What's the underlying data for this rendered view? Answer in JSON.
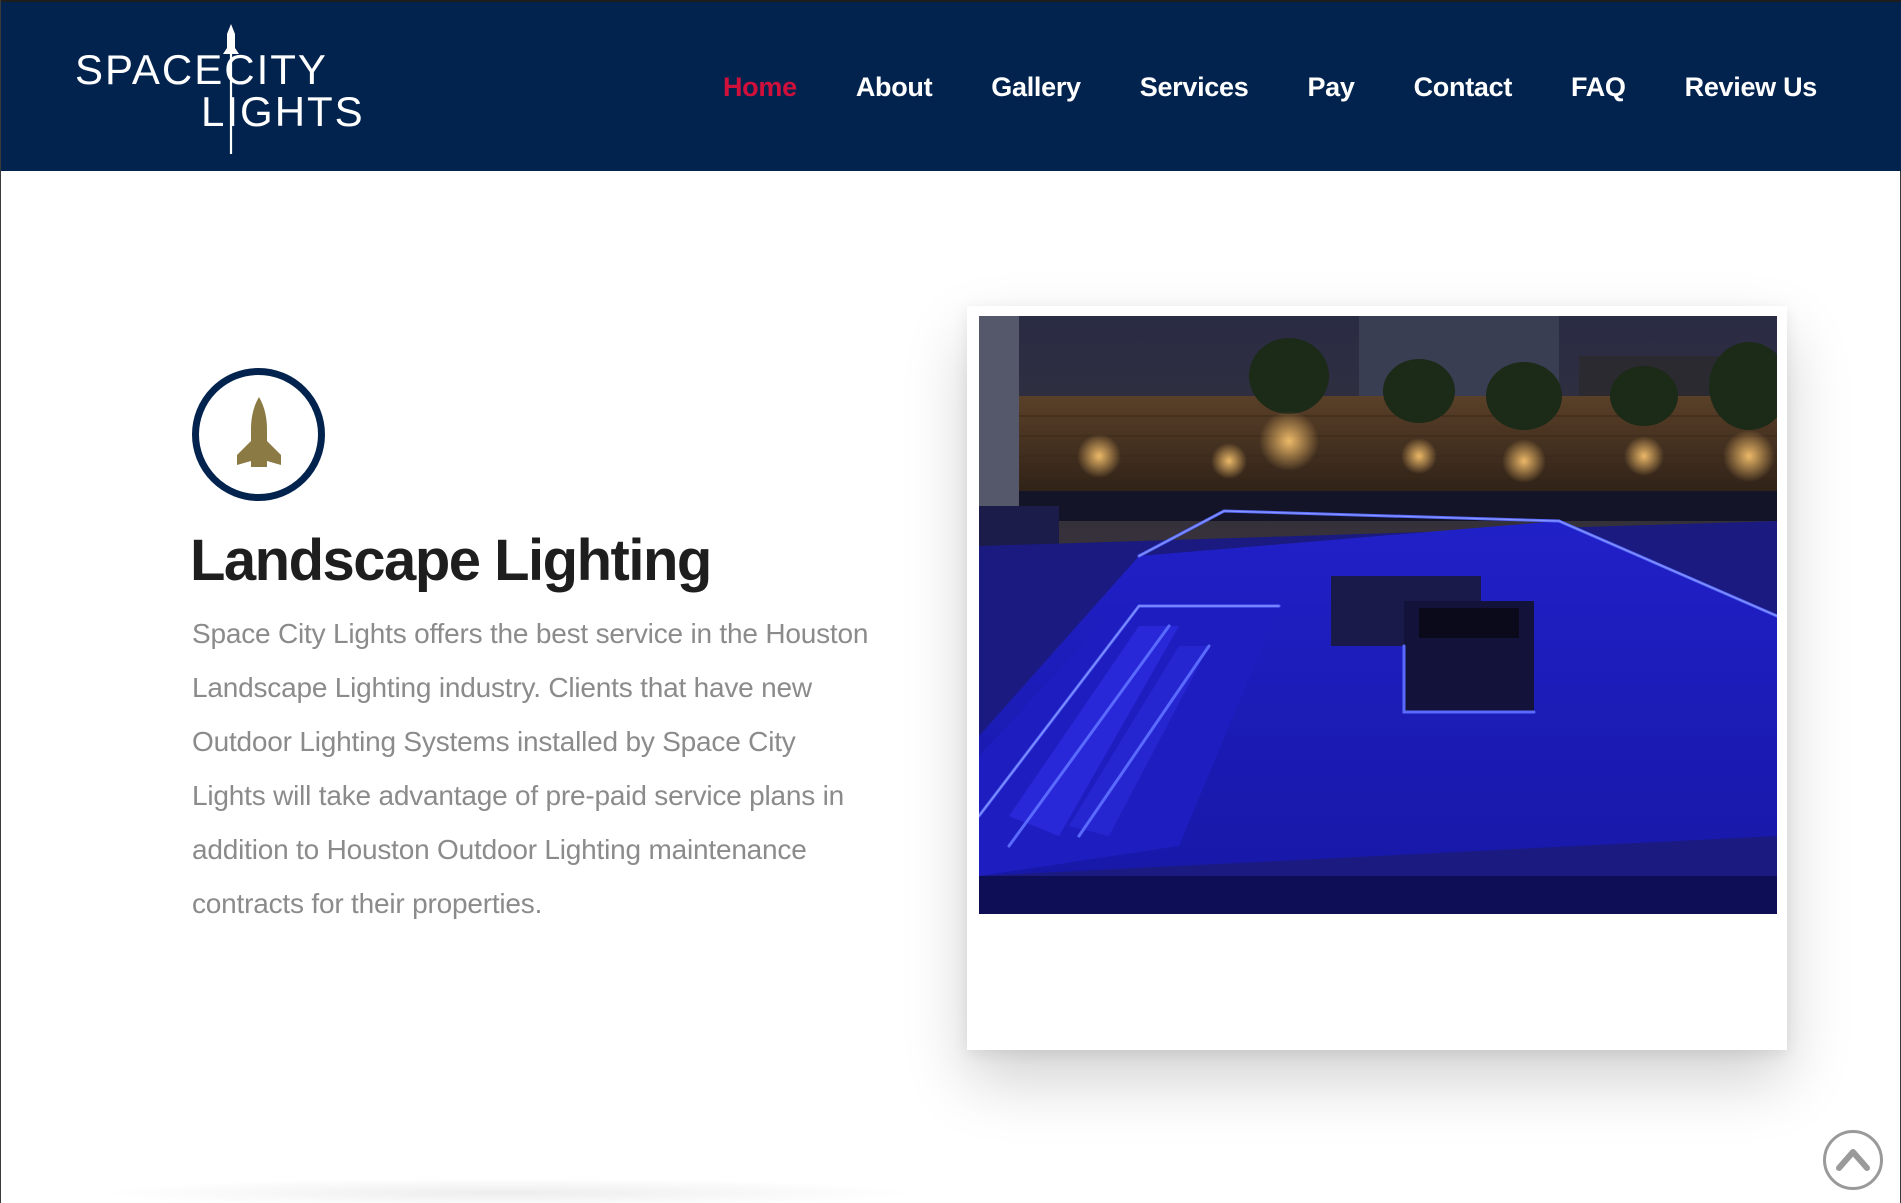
{
  "header": {
    "logo": {
      "line1": "SPACECITY",
      "line2": "LIGHTS",
      "alt": "Space City Lights"
    },
    "nav": [
      {
        "label": "Home",
        "active": true
      },
      {
        "label": "About",
        "active": false
      },
      {
        "label": "Gallery",
        "active": false
      },
      {
        "label": "Services",
        "active": false
      },
      {
        "label": "Pay",
        "active": false
      },
      {
        "label": "Contact",
        "active": false
      },
      {
        "label": "FAQ",
        "active": false
      },
      {
        "label": "Review Us",
        "active": false
      }
    ]
  },
  "service": {
    "icon": "rocket-icon",
    "title": "Landscape Lighting",
    "description": "Space City Lights offers the best service in the Houston Landscape Lighting industry. Clients that have new Outdoor Lighting Systems installed by Space City Lights will take advantage of pre-paid service plans in addition to Houston Outdoor Lighting maintenance contracts for their properties."
  },
  "photo": {
    "subject": "backyard-pool-blue-led-lighting"
  },
  "scroll_top": {
    "icon": "chevron-up-icon"
  },
  "colors": {
    "header_bg": "#03234f",
    "nav_text": "#ffffff",
    "nav_active": "#d0103a",
    "icon_gold": "#8c7a45",
    "title": "#1e1e1e",
    "body_text": "#8b8b8b",
    "led_blue": "#2a2aff"
  }
}
